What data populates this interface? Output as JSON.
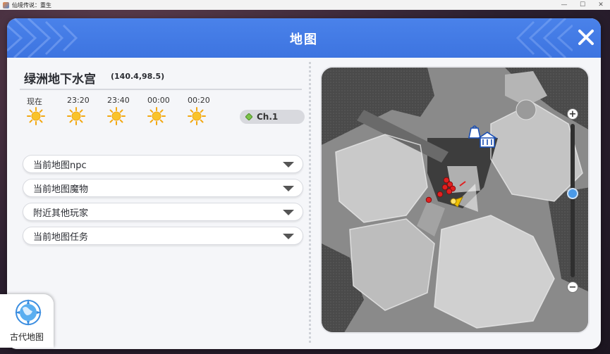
{
  "window": {
    "title": "仙境传说：重生"
  },
  "dialog": {
    "title": "地图"
  },
  "location": {
    "name": "绿洲地下水宫",
    "coords": "(140.4,98.5)"
  },
  "weather": [
    {
      "time": "现在",
      "icon": "sun-icon"
    },
    {
      "time": "23:20",
      "icon": "sun-icon"
    },
    {
      "time": "23:40",
      "icon": "sun-icon"
    },
    {
      "time": "00:00",
      "icon": "sun-icon"
    },
    {
      "time": "00:20",
      "icon": "sun-icon"
    }
  ],
  "channel": {
    "label": "Ch.1"
  },
  "dropdowns": [
    {
      "label": "当前地图npc"
    },
    {
      "label": "当前地图魔物"
    },
    {
      "label": "附近其他玩家"
    },
    {
      "label": "当前地图任务"
    }
  ],
  "zoom": {
    "plus": "+",
    "minus": "−",
    "level": 0.55
  },
  "ancient_map": {
    "label": "古代地图"
  },
  "colors": {
    "header": "#3d74e0",
    "accent": "#4a9ae8",
    "monster": "#e02020",
    "player": "#f2c200"
  }
}
